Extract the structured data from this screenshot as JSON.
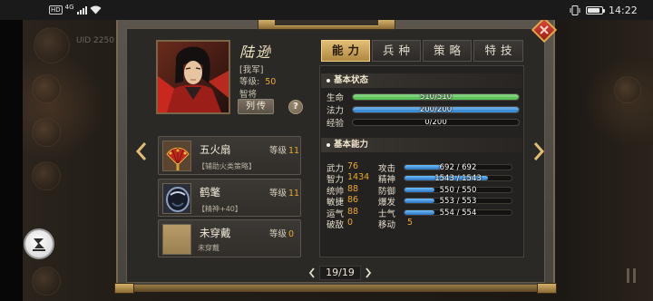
{
  "status_bar": {
    "hd_label": "HD",
    "network_label": "4G",
    "time": "14:22",
    "battery_level": 0.85,
    "icons": [
      "signal-icon",
      "wifi-icon",
      "vibrate-icon",
      "battery-icon"
    ]
  },
  "background": {
    "uid_label": "UID 2250"
  },
  "hero": {
    "name": "陆逊",
    "faction": "[我军]",
    "level_label": "等级:",
    "level_value": "50",
    "class": "智将",
    "bio_button": "列传",
    "help_button": "?"
  },
  "equipment": [
    {
      "name": "五火扇",
      "level_label": "等级",
      "level": "11",
      "desc": "【辅助火类策略】",
      "icon": "fire-fan-icon"
    },
    {
      "name": "鹤氅",
      "level_label": "等级",
      "level": "11",
      "desc": "【精神+40】",
      "icon": "crane-cloak-icon"
    },
    {
      "name": "未穿戴",
      "level_label": "等级",
      "level": "0",
      "desc": "未穿戴",
      "icon": "empty-slot-icon"
    }
  ],
  "tabs": [
    {
      "label": "能力",
      "active": true
    },
    {
      "label": "兵种",
      "active": false
    },
    {
      "label": "策略",
      "active": false
    },
    {
      "label": "特技",
      "active": false
    }
  ],
  "basic_status": {
    "title": "基本状态",
    "rows": [
      {
        "label": "生命",
        "value": "510/510",
        "fill": 1.0,
        "color": "#5cc45a"
      },
      {
        "label": "法力",
        "value": "200/200",
        "fill": 1.0,
        "color": "#3a8fd8"
      },
      {
        "label": "经验",
        "value": "0/200",
        "fill": 0,
        "color": "#3a8fd8"
      }
    ]
  },
  "basic_ability": {
    "title": "基本能力",
    "attributes": [
      {
        "label": "武力",
        "value": "76"
      },
      {
        "label": "智力",
        "value": "1434"
      },
      {
        "label": "统帅",
        "value": "88"
      },
      {
        "label": "敏捷",
        "value": "86"
      },
      {
        "label": "运气",
        "value": "88"
      },
      {
        "label": "破敌",
        "value": "0"
      }
    ],
    "combat": [
      {
        "label": "攻击",
        "value": "692 / 692",
        "fill": 0.35
      },
      {
        "label": "精神",
        "value": "1543 / 1543",
        "fill": 0.78
      },
      {
        "label": "防御",
        "value": "550 / 550",
        "fill": 0.28
      },
      {
        "label": "爆发",
        "value": "553 / 553",
        "fill": 0.28
      },
      {
        "label": "士气",
        "value": "554 / 554",
        "fill": 0.28
      }
    ],
    "move": {
      "label": "移动",
      "value": "5"
    }
  },
  "pagination": {
    "current": "19/19"
  },
  "colors": {
    "accent_gold": "#e8a82a",
    "tab_active": "#d0a85a",
    "hp": "#5cc45a",
    "mp": "#3a8fd8",
    "combat_bar": "#3d8fe0",
    "close_button": "#c0392b"
  }
}
